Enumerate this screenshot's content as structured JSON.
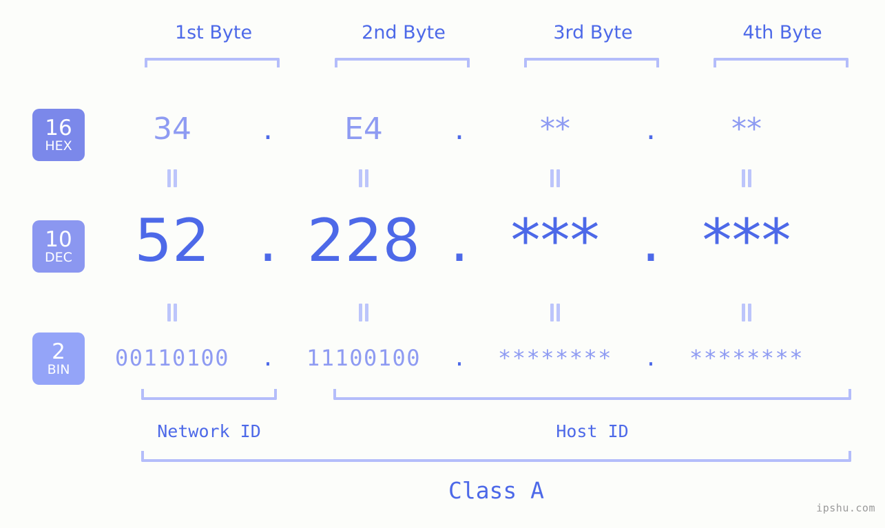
{
  "background_color": "#fcfdfa",
  "accent_color": "#4d69e8",
  "accent_light_color": "#8e9bf2",
  "bracket_color": "#b4bdfa",
  "headers": [
    {
      "label": "1st Byte"
    },
    {
      "label": "2nd Byte"
    },
    {
      "label": "3rd Byte"
    },
    {
      "label": "4th Byte"
    }
  ],
  "bases": [
    {
      "number": "16",
      "name": "HEX",
      "color": "#7b88ea"
    },
    {
      "number": "10",
      "name": "DEC",
      "color": "#8b97f0"
    },
    {
      "number": "2",
      "name": "BIN",
      "color": "#94a4f8"
    }
  ],
  "separator": ".",
  "rows": {
    "hex": {
      "base_number": "16",
      "base_name": "HEX",
      "values": [
        "34",
        "E4",
        "**",
        "**"
      ]
    },
    "dec": {
      "base_number": "10",
      "base_name": "DEC",
      "values": [
        "52",
        "228",
        "***",
        "***"
      ]
    },
    "bin": {
      "base_number": "2",
      "base_name": "BIN",
      "values": [
        "00110100",
        "11100100",
        "********",
        "********"
      ]
    }
  },
  "equals_symbol": "=",
  "sections": [
    {
      "label": "Network ID"
    },
    {
      "label": "Host ID"
    }
  ],
  "class": {
    "label": "Class A"
  },
  "watermark": {
    "text": "ipshu.com"
  }
}
